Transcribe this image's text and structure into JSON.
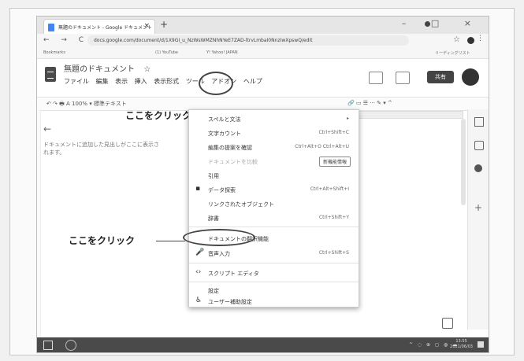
{
  "browser": {
    "tab_title": "無題のドキュメント - Google ドキュメント",
    "tab_close": "×",
    "new_tab": "+",
    "window_controls": "– □ ×",
    "nav_icons": "← → C ⌂",
    "url": "docs.google.com/document/d/1X9GI_u_NzWsWMZNhNYeE7ZAD-ltrvLmbaI0NnzIwXpswQ/edit",
    "star_icon": "☆",
    "menu_dots": "⋮",
    "bookmarks": [
      "Bookmarks",
      "(1) YouTube",
      "Y! Yahoo! JAPAN",
      "リーディングリスト"
    ]
  },
  "doc": {
    "title": "無題のドキュメント",
    "title_star": "☆",
    "menus": [
      "ファイル",
      "編集",
      "表示",
      "挿入",
      "表示形式",
      "ツール",
      "アドオン",
      "ヘルプ"
    ],
    "share_label": "共有",
    "toolbar_left": "↶ ↷ 🖶 A  100% ▾  標準テキスト",
    "toolbar_right": "🔗 ▭ ☰ ···  ✎ ▾ ^",
    "outline_back": "←",
    "outline_text": "ドキュメントに追加した見出しがここに表示されます。"
  },
  "tools_menu": {
    "items": [
      {
        "label": "スペルと文法",
        "shortcut": "▸"
      },
      {
        "label": "文字カウント",
        "shortcut": "Ctrl+Shift+C"
      },
      {
        "label": "編集の提案を確認",
        "shortcut": "Ctrl+Alt+O Ctrl+Alt+U"
      },
      {
        "label": "ドキュメントを比較",
        "badge": "新機能情報",
        "disabled": true
      },
      {
        "label": "引用"
      },
      {
        "label": "データ探索",
        "shortcut": "Ctrl+Alt+Shift+I",
        "icon": "▪"
      },
      {
        "label": "リンクされたオブジェクト"
      },
      {
        "label": "辞書",
        "shortcut": "Ctrl+Shift+Y"
      },
      {
        "label": "ドキュメントの翻訳機能"
      },
      {
        "label": "音声入力",
        "shortcut": "Ctrl+Shift+S",
        "icon": "🎤"
      },
      {
        "label": "スクリプト エディタ",
        "icon": "‹›"
      },
      {
        "label": "設定"
      },
      {
        "label": "ユーザー補助設定",
        "icon": "♿"
      }
    ]
  },
  "annotations": {
    "click_here_1": "ここをクリック",
    "click_here_2": "ここをクリック"
  },
  "taskbar": {
    "clock_time": "13:55",
    "clock_date": "2021/06/03"
  }
}
